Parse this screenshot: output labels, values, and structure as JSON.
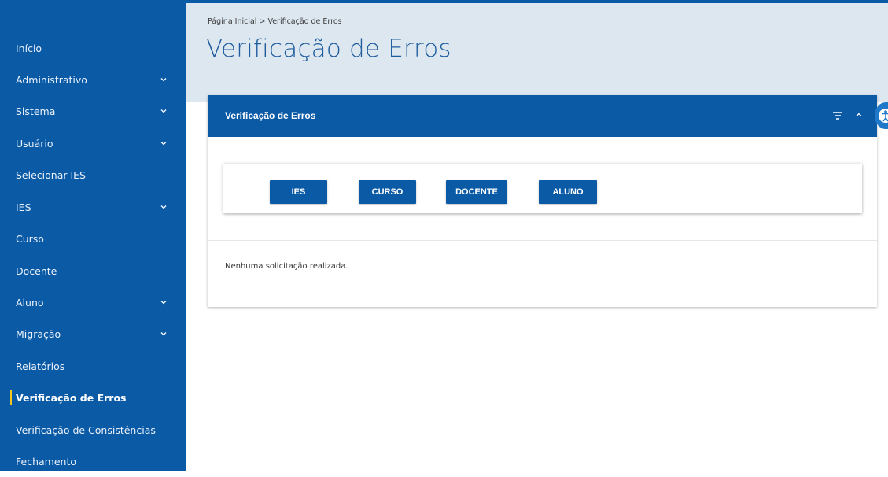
{
  "colors": {
    "brand_blue": "#0b5aa6",
    "header_band": "#dde7f0",
    "active_marker": "#f2c81e",
    "title_blue": "#1f5c9e"
  },
  "sidebar": {
    "items": [
      {
        "label": "Início",
        "has_submenu": false,
        "active": false
      },
      {
        "label": "Administrativo",
        "has_submenu": true,
        "active": false
      },
      {
        "label": "Sistema",
        "has_submenu": true,
        "active": false
      },
      {
        "label": "Usuário",
        "has_submenu": true,
        "active": false
      },
      {
        "label": "Selecionar IES",
        "has_submenu": false,
        "active": false
      },
      {
        "label": "IES",
        "has_submenu": true,
        "active": false
      },
      {
        "label": "Curso",
        "has_submenu": false,
        "active": false
      },
      {
        "label": "Docente",
        "has_submenu": false,
        "active": false
      },
      {
        "label": "Aluno",
        "has_submenu": true,
        "active": false
      },
      {
        "label": "Migração",
        "has_submenu": true,
        "active": false
      },
      {
        "label": "Relatórios",
        "has_submenu": false,
        "active": false
      },
      {
        "label": "Verificação de Erros",
        "has_submenu": false,
        "active": true
      },
      {
        "label": "Verificação de Consistências",
        "has_submenu": false,
        "active": false
      },
      {
        "label": "Fechamento",
        "has_submenu": false,
        "active": false
      }
    ]
  },
  "header": {
    "breadcrumb": "Página Inicial > Verificação de Erros",
    "title": "Verificação de Erros"
  },
  "card": {
    "title": "Verificação de Erros",
    "icons": [
      "filter-icon",
      "chevron-up-icon",
      "accessibility-icon"
    ],
    "buttons": [
      "IES",
      "CURSO",
      "DOCENTE",
      "ALUNO"
    ],
    "empty_message": "Nenhuma solicitação realizada."
  }
}
